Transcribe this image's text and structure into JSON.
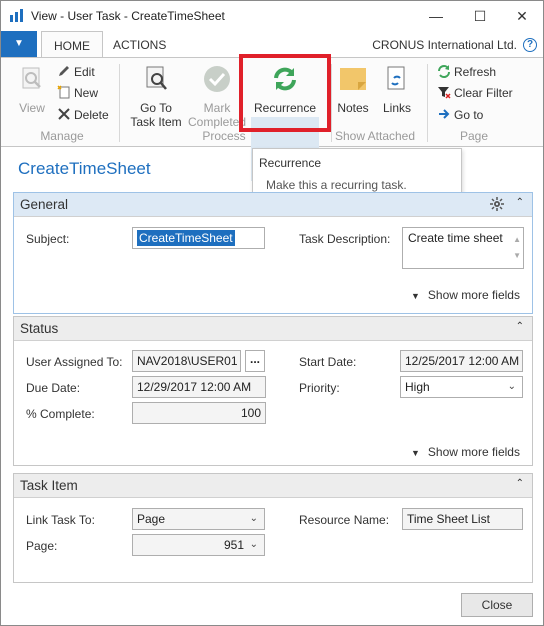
{
  "window": {
    "title": "View - User Task - CreateTimeSheet",
    "minimize": "—",
    "maximize": "☐",
    "close": "✕"
  },
  "ribbon_tabs": {
    "menu_glyph": "▼",
    "home": "HOME",
    "actions": "ACTIONS",
    "company": "CRONUS International Ltd.",
    "help": "?"
  },
  "ribbon": {
    "manage": {
      "label": "Manage",
      "view": "View",
      "edit": "Edit",
      "new": "New",
      "delete": "Delete"
    },
    "process": {
      "label": "Process",
      "go_to_task_item_l1": "Go To",
      "go_to_task_item_l2": "Task Item",
      "mark_completed_l1": "Mark",
      "mark_completed_l2": "Completed",
      "recurrence": "Recurrence"
    },
    "show_attached": {
      "label": "Show Attached",
      "notes": "Notes",
      "links": "Links"
    },
    "page": {
      "label": "Page",
      "refresh": "Refresh",
      "clear_filter": "Clear Filter",
      "go_to": "Go to"
    }
  },
  "tooltip": {
    "title": "Recurrence",
    "description": "Make this a recurring task."
  },
  "page_title": "CreateTimeSheet",
  "general": {
    "title": "General",
    "collapse": "⌃",
    "subject_label": "Subject:",
    "subject_value": "CreateTimeSheet",
    "task_description_label": "Task Description:",
    "task_description_value": "Create time sheet",
    "show_more": "Show more fields"
  },
  "status": {
    "title": "Status",
    "user_assigned_label": "User Assigned To:",
    "user_assigned_value": "NAV2018\\USER01",
    "lookup": "...",
    "start_date_label": "Start Date:",
    "start_date_value": "12/25/2017 12:00 AM",
    "due_date_label": "Due Date:",
    "due_date_value": "12/29/2017 12:00 AM",
    "priority_label": "Priority:",
    "priority_value": "High",
    "complete_label": "% Complete:",
    "complete_value": "100",
    "show_more": "Show more fields"
  },
  "task_item": {
    "title": "Task Item",
    "link_task_to_label": "Link Task To:",
    "link_task_to_value": "Page",
    "resource_name_label": "Resource Name:",
    "resource_name_value": "Time Sheet List",
    "page_label": "Page:",
    "page_value": "951"
  },
  "footer": {
    "close": "Close"
  },
  "colors": {
    "accent": "#1e6fbf",
    "highlight_border": "#e0202a",
    "refresh_green": "#3ea55a"
  }
}
